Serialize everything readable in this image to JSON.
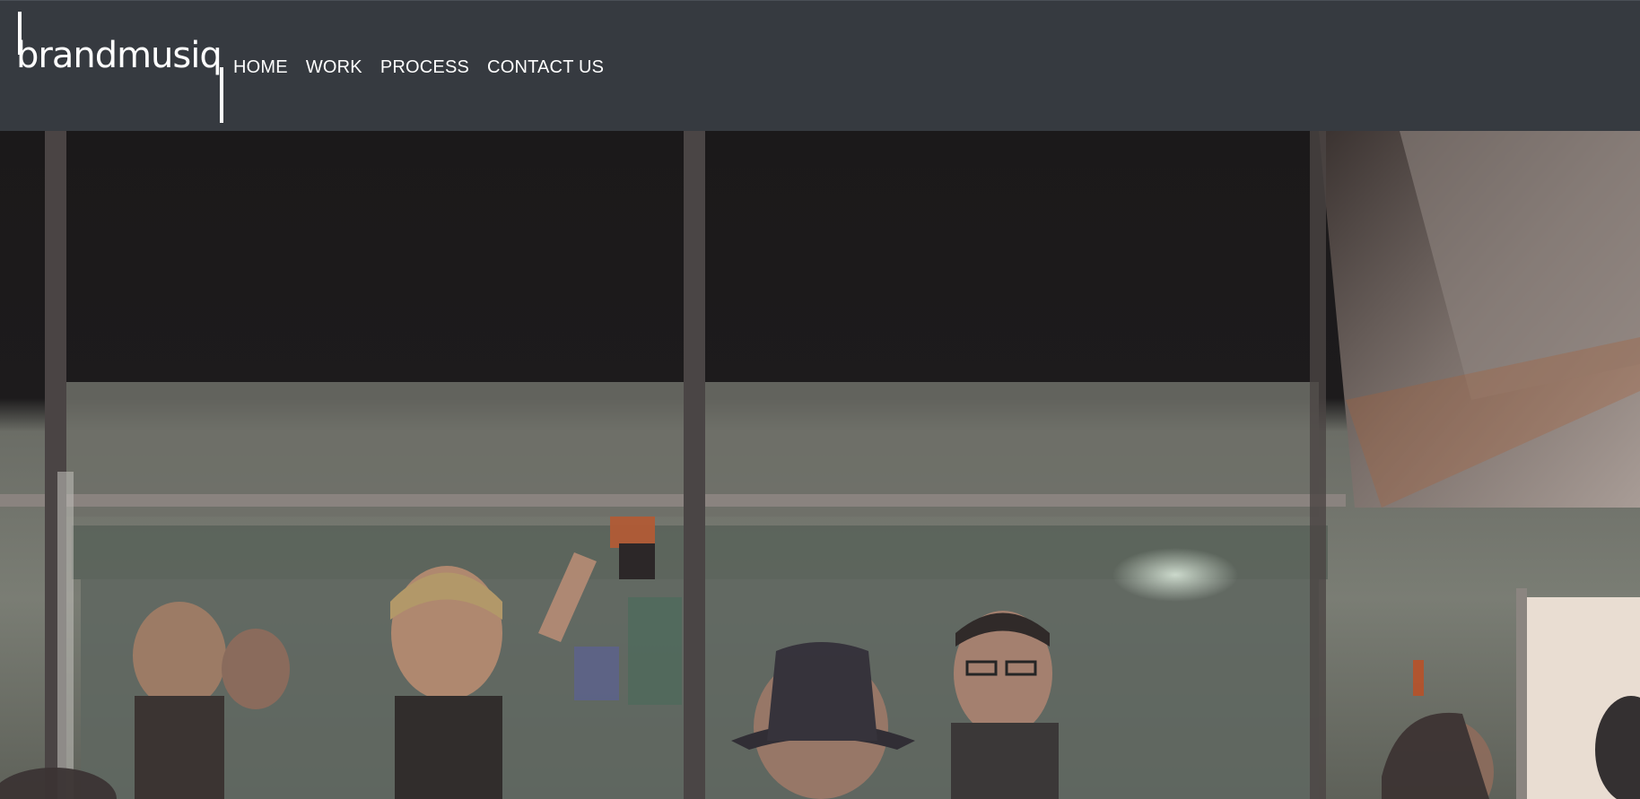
{
  "site": {
    "logo_text": "brandmusiq"
  },
  "nav": {
    "items": [
      {
        "label": "HOME"
      },
      {
        "label": "WORK"
      },
      {
        "label": "PROCESS"
      },
      {
        "label": "CONTACT US"
      }
    ]
  },
  "colors": {
    "header_bg": "#363a40",
    "nav_text": "#ffffff",
    "hero_dark": "#1a1819"
  },
  "hero": {
    "icon": "video-background"
  }
}
